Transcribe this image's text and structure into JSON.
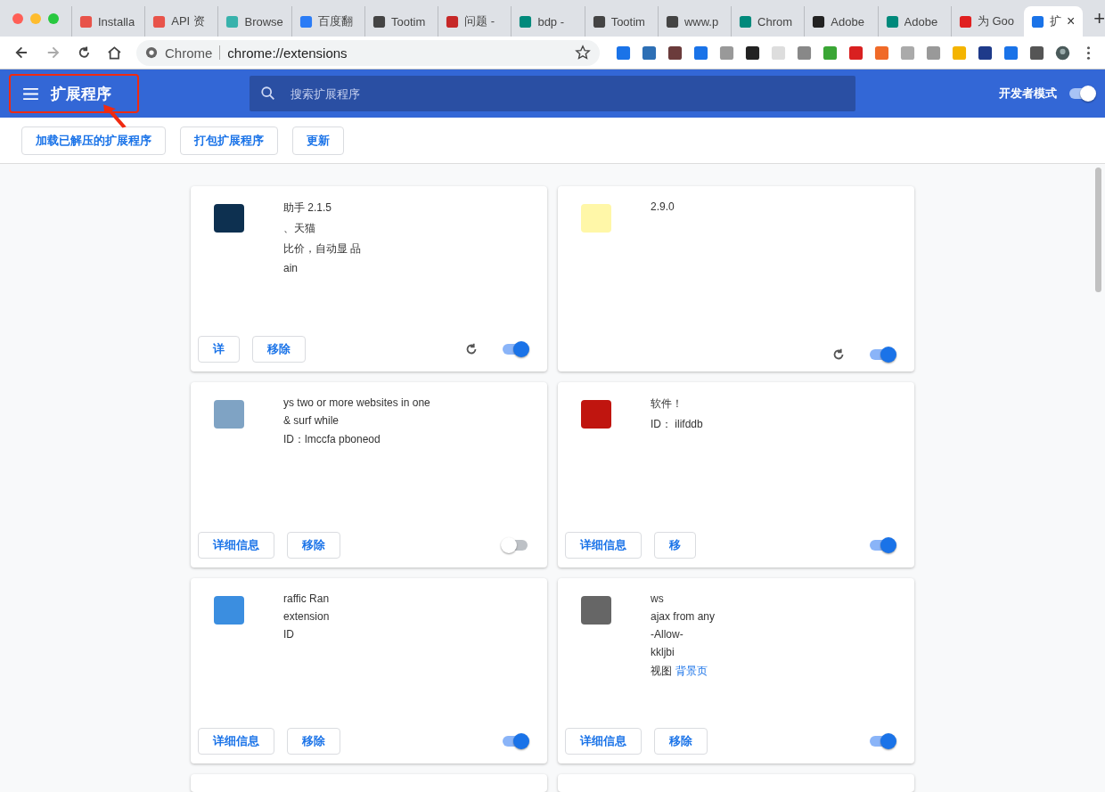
{
  "tabs": [
    {
      "title": "Installa",
      "selected": false
    },
    {
      "title": "API 资",
      "selected": false
    },
    {
      "title": "Browse",
      "selected": false
    },
    {
      "title": "百度翻",
      "selected": false
    },
    {
      "title": "Tootim",
      "selected": false
    },
    {
      "title": "问题 -",
      "selected": false
    },
    {
      "title": "bdp - ",
      "selected": false
    },
    {
      "title": "Tootim",
      "selected": false
    },
    {
      "title": "www.p",
      "selected": false
    },
    {
      "title": "Chrom",
      "selected": false
    },
    {
      "title": "Adobe",
      "selected": false
    },
    {
      "title": "Adobe",
      "selected": false
    },
    {
      "title": "为 Goo",
      "selected": false
    },
    {
      "title": "扩",
      "selected": true,
      "close": "×"
    }
  ],
  "new_tab": "+",
  "address": {
    "chip": "Chrome",
    "url": "chrome://extensions"
  },
  "header": {
    "title": "扩展程序",
    "search_placeholder": "搜索扩展程序",
    "dev_mode_label": "开发者模式",
    "dev_mode_on": true
  },
  "actions": [
    "加载已解压的扩展程序",
    "打包扩展程序",
    "更新"
  ],
  "cards": [
    {
      "lines": [
        "助手 2.1.5",
        "、天猫",
        "比价，自动显  品",
        "ain"
      ],
      "details": "详",
      "remove": "移除",
      "reload": true,
      "enabled": true
    },
    {
      "lines": [
        "2.9.0"
      ],
      "reload": true,
      "enabled": true
    },
    {
      "lines": [
        "ys two or more websites in one",
        "& surf            while",
        "ID：lmccfa     pboneod"
      ],
      "details": "详细信息",
      "remove": "移除",
      "reload": false,
      "enabled": false
    },
    {
      "lines": [
        "软件！",
        "ID：                      ilifddb"
      ],
      "details": "详细信息",
      "remove": "移",
      "reload": false,
      "enabled": true
    },
    {
      "lines": [
        "raffic Ran",
        "extension",
        "ID"
      ],
      "details": "详细信息",
      "remove": "移除",
      "reload": false,
      "enabled": true
    },
    {
      "lines": [
        "ws",
        "ajax from any",
        "-Allow-",
        "kkljbi"
      ],
      "link_prefix": "视图",
      "link": "背景页",
      "details": "详细信息",
      "remove": "移除",
      "reload": false,
      "enabled": true
    }
  ],
  "annotation": {
    "shown": true
  }
}
